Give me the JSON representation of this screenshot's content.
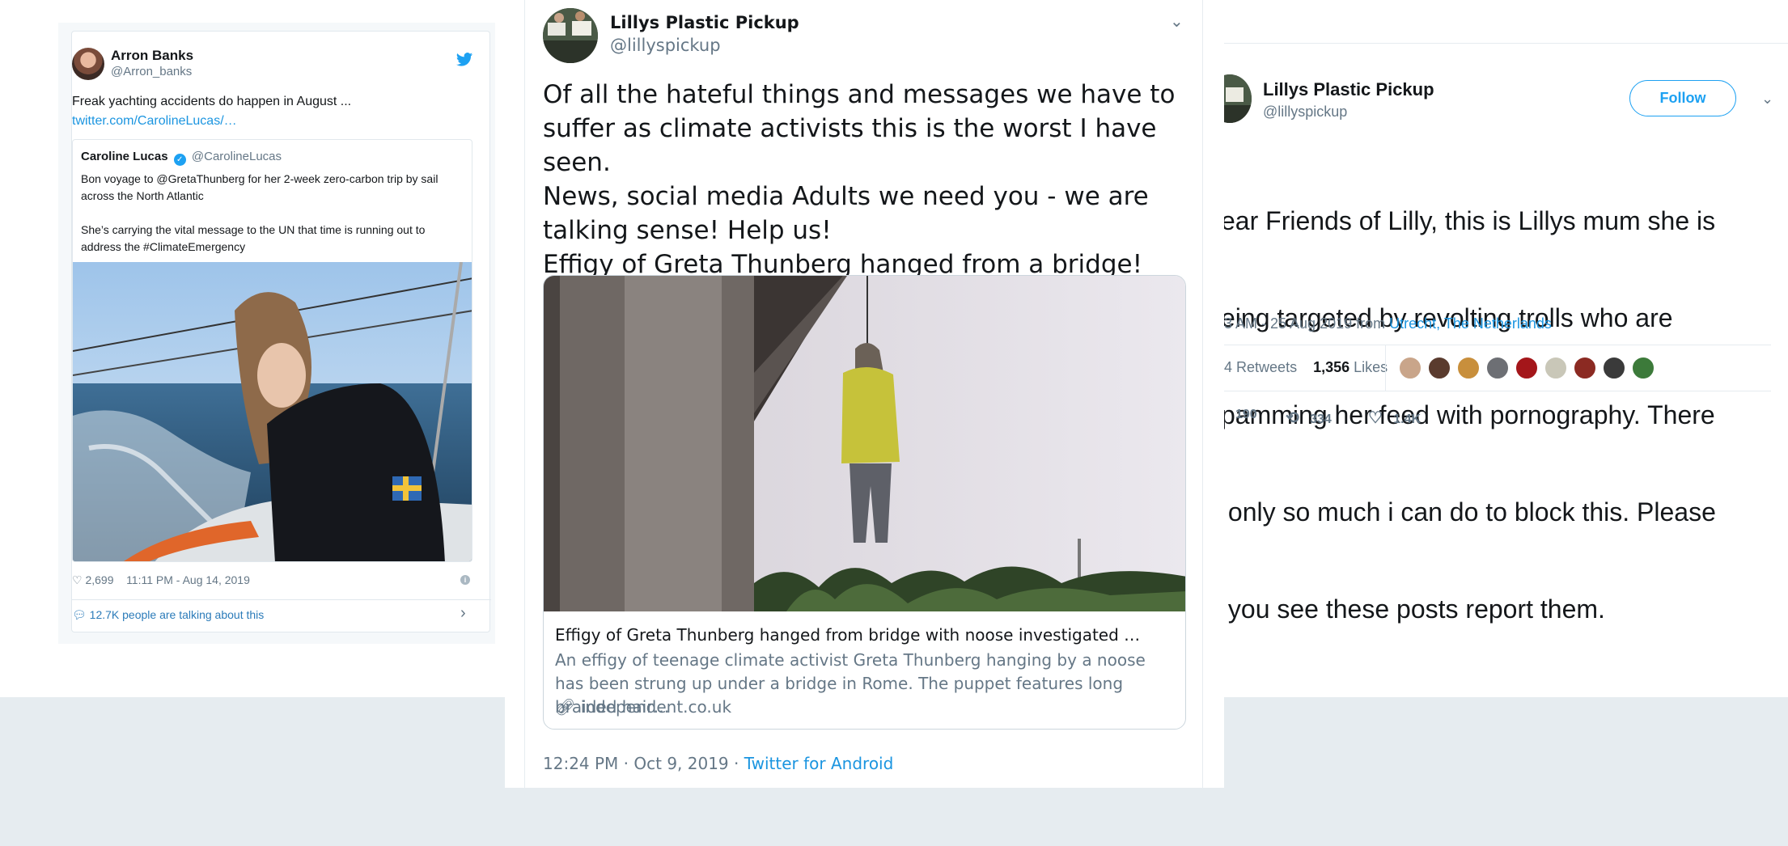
{
  "left_tweet": {
    "author_name": "Arron Banks",
    "author_handle": "@Arron_banks",
    "text": "Freak yachting accidents do happen in August ...",
    "link": "twitter.com/CarolineLucas/…",
    "quoted": {
      "author_name": "Caroline Lucas",
      "author_handle": "@CarolineLucas",
      "text_1": "Bon voyage to @GretaThunberg for her 2-week zero-carbon trip by sail across the North Atlantic",
      "text_2": "She’s carrying the vital message to the UN that time is running out to address the #ClimateEmergency"
    },
    "likes": "2,699",
    "timestamp": "11:11 PM - Aug 14, 2019",
    "talking": "12.7K people are talking about this"
  },
  "middle_tweet": {
    "author_name": "Lillys Plastic Pickup",
    "author_handle": "@lillyspickup",
    "text_lines": [
      "Of all the hateful things and messages we have to",
      "suffer as climate activists this is the worst I have seen.",
      "News, social media Adults we need you - we are",
      "talking sense! Help us!",
      "Effigy of Greta Thunberg hanged from a bridge!"
    ],
    "card": {
      "title": "Effigy of Greta Thunberg hanged from bridge with noose investigated …",
      "description": "An effigy of teenage climate activist Greta Thunberg hanging by a noose has been strung up under a bridge in Rome. The puppet features long braided hair…",
      "domain": "independent.co.uk"
    },
    "timestamp": "12:24 PM · Oct 9, 2019 ·",
    "source": "Twitter for Android"
  },
  "right_tweet": {
    "author_name": "Lillys Plastic Pickup",
    "author_handle": "@lillyspickup",
    "follow_label": "Follow",
    "text_lines": [
      "ear Friends of Lilly, this is Lillys mum she is",
      "eing targeted by revolting trolls who are",
      "pamming her feed with pornography. There",
      " only so much i can do to block this. Please",
      " you see these posts report them."
    ],
    "meta_time": "3 AM - 25 Aug 2019 from",
    "location": "Utrecht, The Netherlands",
    "retweets_label": "Retweets",
    "retweets_partial": "4",
    "likes_count": "1,356",
    "likes_label": "Likes",
    "replies": "190",
    "retweets": "334",
    "likes_short": "1.4K"
  },
  "colors": {
    "link_blue": "#1b95e0",
    "twitter_blue": "#1da1f2",
    "muted_gray": "#657786",
    "background_gray": "#e6ecf0"
  },
  "icons": [
    "twitter-bird-icon",
    "verified-badge-icon",
    "heart-icon",
    "info-icon",
    "comment-icon",
    "chevron-right-icon",
    "chevron-down-icon",
    "link-icon",
    "reply-icon",
    "retweet-icon"
  ]
}
